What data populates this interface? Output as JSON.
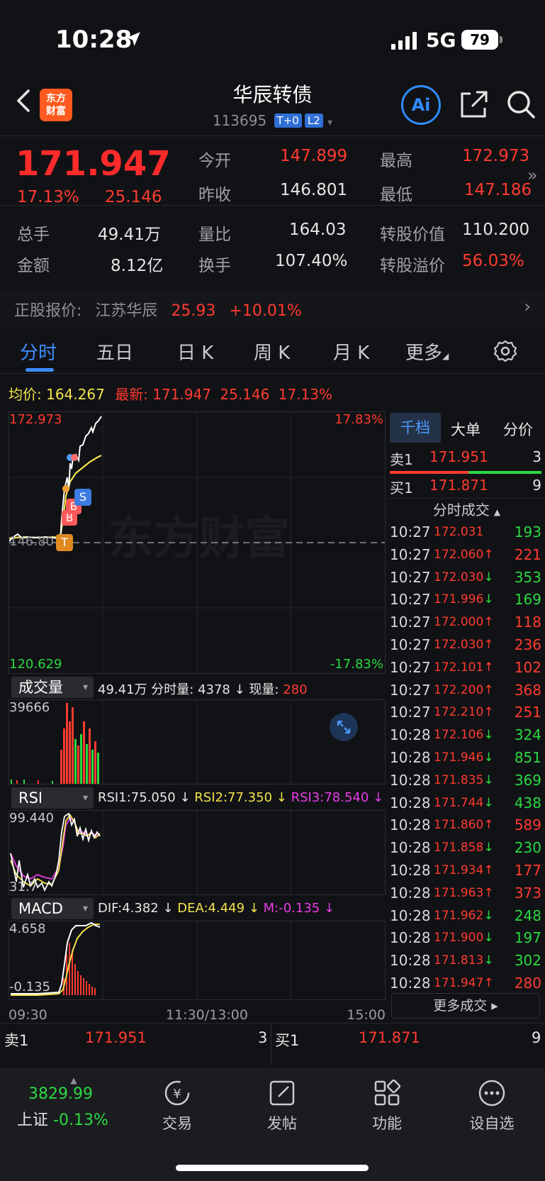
{
  "status_bar": {
    "time": "10:28",
    "network": "5G",
    "battery": "79"
  },
  "header": {
    "logo": "东方财富",
    "title": "华辰转债",
    "code": "113695",
    "tags": [
      "T+0",
      "L2"
    ],
    "ai_label": "Ai"
  },
  "quote": {
    "price": "171.947",
    "pct": "17.13%",
    "change": "25.146",
    "fields": [
      {
        "label": "今开",
        "value": "147.899",
        "color": "#ff3b30"
      },
      {
        "label": "最高",
        "value": "172.973",
        "color": "#ff3b30"
      },
      {
        "label": "昨收",
        "value": "146.801",
        "color": "#e6e6e6"
      },
      {
        "label": "最低",
        "value": "147.186",
        "color": "#ff3b30"
      },
      {
        "label": "总手",
        "value": "49.41万",
        "color": "#e6e6e6"
      },
      {
        "label": "量比",
        "value": "164.03",
        "color": "#e6e6e6"
      },
      {
        "label": "转股价值",
        "value": "110.200",
        "color": "#e6e6e6"
      },
      {
        "label": "金额",
        "value": "8.12亿",
        "color": "#e6e6e6"
      },
      {
        "label": "换手",
        "value": "107.40%",
        "color": "#e6e6e6"
      },
      {
        "label": "转股溢价",
        "value": "56.03%",
        "color": "#ff3b30"
      }
    ]
  },
  "stock_line": {
    "label": "正股报价:",
    "name": "江苏华辰",
    "price": "25.93",
    "pct": "+10.01%"
  },
  "tabs": [
    "分时",
    "五日",
    "日 K",
    "周 K",
    "月 K",
    "更多"
  ],
  "avg_row": {
    "avg_label": "均价:",
    "avg_value": "164.267",
    "latest_label": "最新:",
    "latest_value": "171.947",
    "change": "25.146",
    "pct": "17.13%"
  },
  "chart": {
    "ymax": "172.973",
    "ymin": "120.629",
    "pct_top": "17.83%",
    "pct_bottom": "-17.83%",
    "prev_close": "146.80",
    "watermark": "东方财富",
    "markers": [
      "T",
      "B",
      "B",
      "S"
    ]
  },
  "volume": {
    "label": "成交量",
    "total": "49.41万",
    "min_vol_label": "分时量:",
    "min_vol": "4378 ↓",
    "cur_label": "现量:",
    "cur": "280",
    "ymax": "39666"
  },
  "rsi": {
    "label": "RSI",
    "rsi1": "RSI1:75.050 ↓",
    "rsi2": "RSI2:77.350 ↓",
    "rsi3": "RSI3:78.540 ↓",
    "ymax": "99.440",
    "ymin": "31.7"
  },
  "macd": {
    "label": "MACD",
    "dif": "DIF:4.382 ↓",
    "dea": "DEA:4.449 ↓",
    "m": "M:-0.135 ↓",
    "ymax": "4.658",
    "ymin": "-0.135"
  },
  "time_axis": {
    "start": "09:30",
    "mid": "11:30/13:00",
    "end": "15:00"
  },
  "right_panel": {
    "segments": [
      "千档",
      "大单",
      "分价"
    ],
    "ask": {
      "label": "卖1",
      "price": "171.951",
      "qty": "3"
    },
    "bid": {
      "label": "买1",
      "price": "171.871",
      "qty": "9"
    },
    "trades_title": "分时成交",
    "trades": [
      {
        "time": "10:27",
        "price": "172.031",
        "dir": "",
        "vol": "193",
        "vc": "green"
      },
      {
        "time": "10:27",
        "price": "172.060",
        "dir": "↑",
        "vol": "221",
        "vc": "red"
      },
      {
        "time": "10:27",
        "price": "172.030",
        "dir": "↓",
        "vol": "353",
        "vc": "green"
      },
      {
        "time": "10:27",
        "price": "171.996",
        "dir": "↓",
        "vol": "169",
        "vc": "green"
      },
      {
        "time": "10:27",
        "price": "172.000",
        "dir": "↑",
        "vol": "118",
        "vc": "red"
      },
      {
        "time": "10:27",
        "price": "172.030",
        "dir": "↑",
        "vol": "236",
        "vc": "red"
      },
      {
        "time": "10:27",
        "price": "172.101",
        "dir": "↑",
        "vol": "102",
        "vc": "red"
      },
      {
        "time": "10:27",
        "price": "172.200",
        "dir": "↑",
        "vol": "368",
        "vc": "red"
      },
      {
        "time": "10:27",
        "price": "172.210",
        "dir": "↑",
        "vol": "251",
        "vc": "red"
      },
      {
        "time": "10:28",
        "price": "172.106",
        "dir": "↓",
        "vol": "324",
        "vc": "green"
      },
      {
        "time": "10:28",
        "price": "171.946",
        "dir": "↓",
        "vol": "851",
        "vc": "green"
      },
      {
        "time": "10:28",
        "price": "171.835",
        "dir": "↓",
        "vol": "369",
        "vc": "green"
      },
      {
        "time": "10:28",
        "price": "171.744",
        "dir": "↓",
        "vol": "438",
        "vc": "green"
      },
      {
        "time": "10:28",
        "price": "171.860",
        "dir": "↑",
        "vol": "589",
        "vc": "red"
      },
      {
        "time": "10:28",
        "price": "171.858",
        "dir": "↓",
        "vol": "230",
        "vc": "green"
      },
      {
        "time": "10:28",
        "price": "171.934",
        "dir": "↑",
        "vol": "177",
        "vc": "red"
      },
      {
        "time": "10:28",
        "price": "171.963",
        "dir": "↑",
        "vol": "373",
        "vc": "red"
      },
      {
        "time": "10:28",
        "price": "171.962",
        "dir": "↓",
        "vol": "248",
        "vc": "green"
      },
      {
        "time": "10:28",
        "price": "171.900",
        "dir": "↓",
        "vol": "197",
        "vc": "green"
      },
      {
        "time": "10:28",
        "price": "171.813",
        "dir": "↓",
        "vol": "302",
        "vc": "green"
      },
      {
        "time": "10:28",
        "price": "171.947",
        "dir": "↑",
        "vol": "280",
        "vc": "red"
      }
    ],
    "more_trades": "更多成交"
  },
  "bottom_orderbook": {
    "ask_label": "卖1",
    "ask_price": "171.951",
    "ask_qty": "3",
    "bid_label": "买1",
    "bid_price": "171.871",
    "bid_qty": "9"
  },
  "nav": {
    "index_value": "3829.99",
    "index_name": "上证",
    "index_pct": "-0.13%",
    "items": [
      "交易",
      "发帖",
      "功能",
      "设自选"
    ]
  }
}
